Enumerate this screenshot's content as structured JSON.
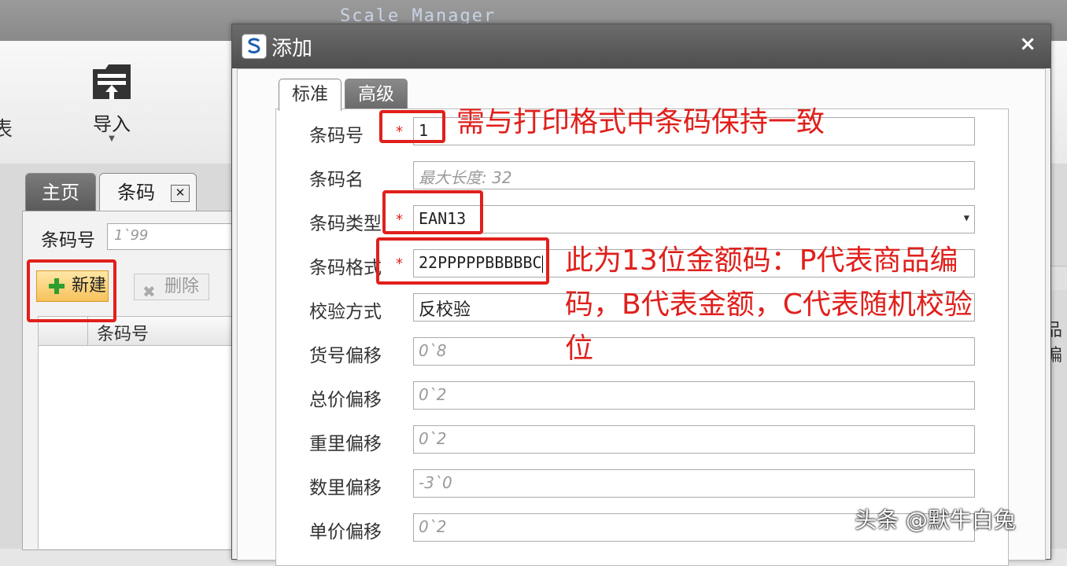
{
  "app": {
    "title": "Scale Manager"
  },
  "ribbon": {
    "left_clipped_label": "表",
    "import_label": "导入"
  },
  "tabs": {
    "home": "主页",
    "barcode": "条码",
    "close_symbol": "✕"
  },
  "search": {
    "label": "条码号",
    "placeholder": "1`99"
  },
  "toolbar": {
    "new_label": "新建",
    "delete_label": "删除"
  },
  "grid": {
    "column_barcode": "条码号",
    "right_clipped_column": "品偏"
  },
  "dialog": {
    "title": "添加",
    "close_symbol": "×",
    "tabs": [
      "标准",
      "高级"
    ],
    "fields": [
      {
        "label": "条码号",
        "value": "1",
        "required": true
      },
      {
        "label": "条码名",
        "placeholder": "最大长度: 32"
      },
      {
        "label": "条码类型",
        "value": "EAN13",
        "required": true,
        "dropdown": true
      },
      {
        "label": "条码格式",
        "value": "22PPPPPBBBBBC",
        "required": true
      },
      {
        "label": "校验方式",
        "value": "反校验"
      },
      {
        "label": "货号偏移",
        "placeholder": "0`8"
      },
      {
        "label": "总价偏移",
        "placeholder": "0`2"
      },
      {
        "label": "重里偏移",
        "placeholder": "0`2"
      },
      {
        "label": "数里偏移",
        "placeholder": "-3`0"
      },
      {
        "label": "单价偏移",
        "placeholder": "0`2"
      }
    ],
    "required_mark": "*"
  },
  "annotations": {
    "barcode_number_note": "需与打印格式中条码保持一致",
    "format_note_line1": "此为13位金额码：P代表商品编",
    "format_note_line2": "码，B代表金额，C代表随机校验",
    "format_note_line3": "位"
  },
  "watermark": "头条 @默牛白兔",
  "colors": {
    "annotation_red": "#e0201c",
    "new_button_orange": "#f7c25c"
  }
}
